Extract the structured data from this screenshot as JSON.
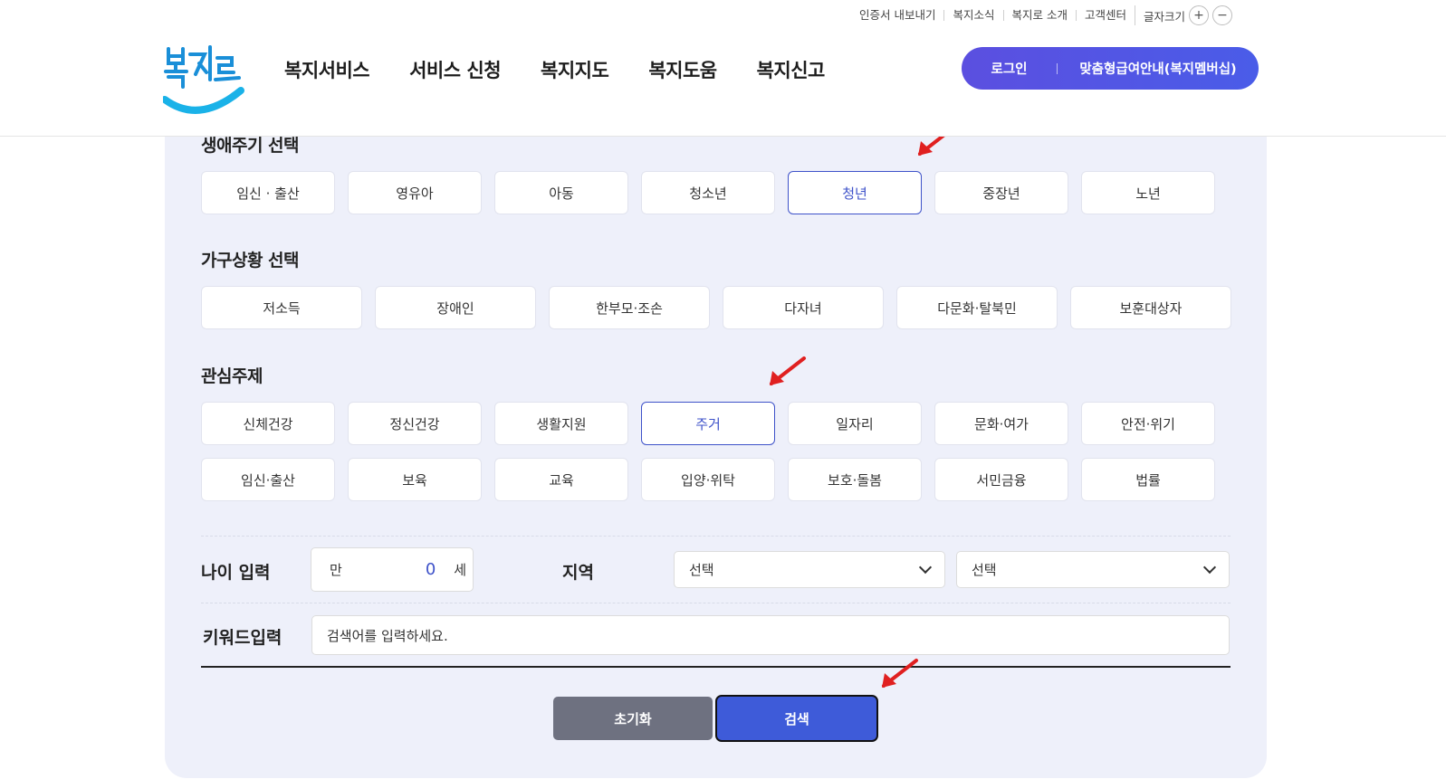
{
  "utility_links": [
    "인증서 내보내기",
    "복지소식",
    "복지로 소개",
    "고객센터"
  ],
  "font_size": {
    "label": "글자크기",
    "plus": "+",
    "minus": "−"
  },
  "logo_text": "복지로",
  "nav": [
    "복지서비스",
    "서비스 신청",
    "복지지도",
    "복지도움",
    "복지신고"
  ],
  "cta": {
    "login": "로그인",
    "membership": "맞춤형급여안내(복지멤버십)"
  },
  "life_cycle": {
    "title": "생애주기 선택",
    "items": [
      "임신 · 출산",
      "영유아",
      "아동",
      "청소년",
      "청년",
      "중장년",
      "노년"
    ],
    "selected": "청년"
  },
  "household": {
    "title": "가구상황 선택",
    "items": [
      "저소득",
      "장애인",
      "한부모·조손",
      "다자녀",
      "다문화·탈북민",
      "보훈대상자"
    ]
  },
  "interest": {
    "title": "관심주제",
    "row1": [
      "신체건강",
      "정신건강",
      "생활지원",
      "주거",
      "일자리",
      "문화·여가",
      "안전·위기"
    ],
    "row2": [
      "임신·출산",
      "보육",
      "교육",
      "입양·위탁",
      "보호·돌봄",
      "서민금융",
      "법률"
    ],
    "selected": "주거"
  },
  "age": {
    "label": "나이 입력",
    "prefix": "만",
    "value": "0",
    "suffix": "세"
  },
  "region": {
    "label": "지역",
    "select1": "선택",
    "select2": "선택"
  },
  "keyword": {
    "label": "키워드입력",
    "placeholder": "검색어를 입력하세요."
  },
  "buttons": {
    "reset": "초기화",
    "search": "검색"
  },
  "colors": {
    "accent": "#3e52c9",
    "panel_bg": "#eef0fa",
    "annotation_arrow": "#e02020"
  }
}
